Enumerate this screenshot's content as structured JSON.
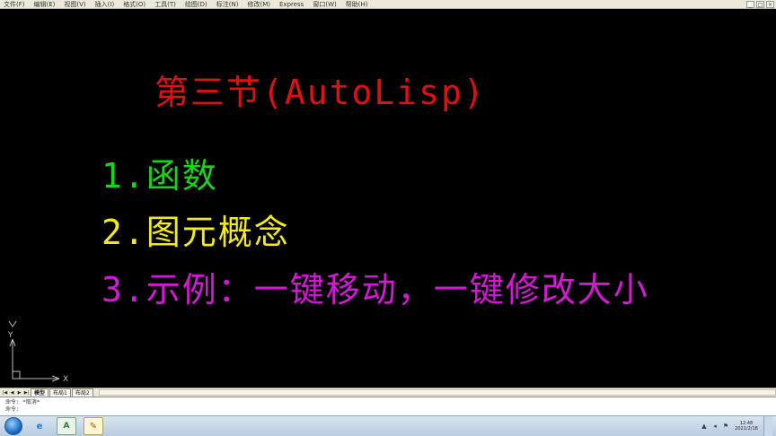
{
  "menubar": {
    "items": [
      "文件(F)",
      "编辑(E)",
      "视图(V)",
      "插入(I)",
      "格式(O)",
      "工具(T)",
      "绘图(D)",
      "标注(N)",
      "修改(M)",
      "Express",
      "窗口(W)",
      "帮助(H)"
    ],
    "window_controls": [
      "_",
      "□",
      "×"
    ]
  },
  "canvas": {
    "title": "第三节(AutoLisp)",
    "items": [
      "1.函数",
      "2.图元概念",
      "3.示例：一键移动，一键修改大小"
    ],
    "colors": {
      "title": "#e01010",
      "item1": "#19d419",
      "item2": "#f2ea1e",
      "item3": "#d21ad2"
    }
  },
  "ucs": {
    "y_label": "Y",
    "x_label": "X"
  },
  "layout_tabs": {
    "nav": [
      "|◀",
      "◀",
      "▶",
      "▶|"
    ],
    "tabs": [
      "模型",
      "布局1",
      "布局2"
    ]
  },
  "command_line": {
    "line1": "命令: *取消*",
    "line2": "命令:"
  },
  "taskbar": {
    "clock_time": "12:48",
    "clock_date": "2021/2/18",
    "buttons": [
      "ie-icon",
      "autocad-icon",
      "app-icon"
    ]
  }
}
